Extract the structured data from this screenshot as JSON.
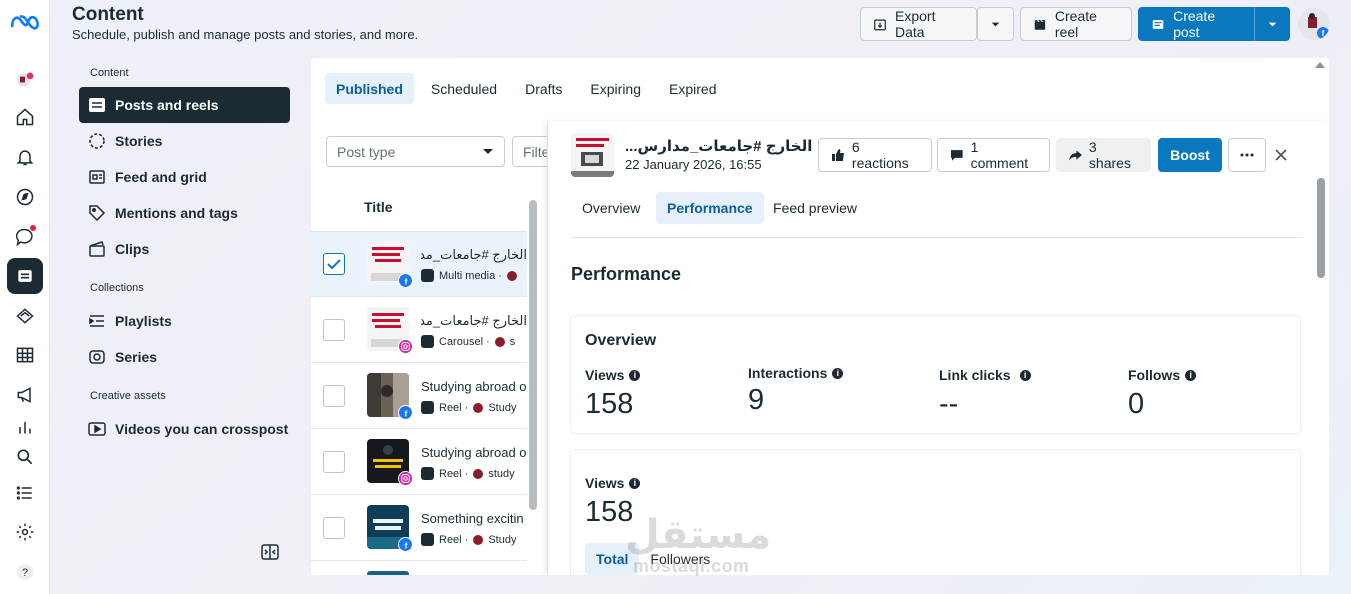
{
  "header": {
    "title": "Content",
    "subtitle": "Schedule, publish and manage posts and stories, and more.",
    "export_label": "Export Data",
    "create_reel_label": "Create reel",
    "create_post_label": "Create post"
  },
  "sidebar": {
    "sections": {
      "content": "Content",
      "collections": "Collections",
      "creative_assets": "Creative assets"
    },
    "items": [
      {
        "label": "Posts and reels",
        "icon": "posts-icon",
        "active": true
      },
      {
        "label": "Stories",
        "icon": "stories-icon"
      },
      {
        "label": "Feed and grid",
        "icon": "feed-grid-icon"
      },
      {
        "label": "Mentions and tags",
        "icon": "tag-icon"
      },
      {
        "label": "Clips",
        "icon": "clips-icon"
      },
      {
        "label": "Playlists",
        "icon": "playlist-icon"
      },
      {
        "label": "Series",
        "icon": "series-icon"
      },
      {
        "label": "Videos you can crosspost",
        "icon": "video-icon"
      }
    ]
  },
  "tabs": [
    "Published",
    "Scheduled",
    "Drafts",
    "Expiring",
    "Expired"
  ],
  "filters": {
    "post_type_placeholder": "Post type",
    "filter_placeholder": "Filter"
  },
  "list": {
    "title_header": "Title",
    "rows": [
      {
        "title": "الخارج #جامعات_مدارس",
        "type": "Multi media ·",
        "network": "facebook",
        "selected": true
      },
      {
        "title": "الخارج #جامعات_مدارس",
        "type": "Carousel ·",
        "network": "instagram",
        "selected": false,
        "extra": "s"
      },
      {
        "title": "Studying abroad o",
        "type": "Reel ·",
        "network": "facebook",
        "selected": false,
        "extra": "Study"
      },
      {
        "title": "Studying abroad o",
        "type": "Reel ·",
        "network": "instagram",
        "selected": false,
        "extra": "study"
      },
      {
        "title": "Something excitin",
        "type": "Reel ·",
        "network": "facebook",
        "selected": false,
        "extra": "Study"
      }
    ]
  },
  "detail": {
    "title": "...الخارج #جامعات_مدارس",
    "date": "22 January 2026, 16:55",
    "reactions_label": "6 reactions",
    "comment_label": "1 comment",
    "shares_label": "3 shares",
    "boost_label": "Boost",
    "tabs": [
      "Overview",
      "Performance",
      "Feed preview"
    ],
    "performance_heading": "Performance",
    "overview": {
      "heading": "Overview",
      "metrics": [
        {
          "label": "Views",
          "value": "158"
        },
        {
          "label": "Interactions",
          "value": "9"
        },
        {
          "label": "Link clicks",
          "value": "--"
        },
        {
          "label": "Follows",
          "value": "0"
        }
      ]
    },
    "views_card": {
      "label": "Views",
      "value": "158",
      "segments": [
        "Total",
        "Followers"
      ]
    }
  },
  "watermark": {
    "line1": "مستقل",
    "line2": "mostaql.com"
  },
  "colors": {
    "accent": "#0a78be",
    "dark": "#1c2b33",
    "active_tab_bg": "#e6f0fa",
    "facebook": "#1877f2"
  }
}
